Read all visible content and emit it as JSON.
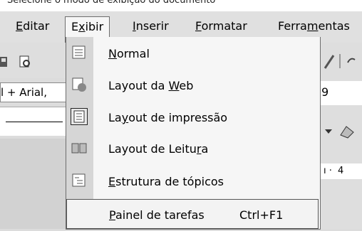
{
  "caption": "Selecione o modo de exibição do documento",
  "menubar": {
    "items": [
      {
        "label": "Editar",
        "ul": "E"
      },
      {
        "label": "Exibir",
        "ul": "x"
      },
      {
        "label": "Inserir",
        "ul": "I"
      },
      {
        "label": "Formatar",
        "ul": "F"
      },
      {
        "label": "Ferramentas",
        "ul": "m"
      }
    ]
  },
  "font_box": {
    "value": "l + Arial,"
  },
  "size_box": {
    "value": "9"
  },
  "ruler": {
    "mark": "4"
  },
  "dropdown": {
    "items": [
      {
        "label": "Normal",
        "ul_index": 0
      },
      {
        "label": "Layout da Web",
        "ul_index": 10
      },
      {
        "label": "Layout de impressão",
        "ul_index": 2
      },
      {
        "label": "Layout de Leitura",
        "ul_index": 15
      },
      {
        "label": "Estrutura de tópicos",
        "ul_index": 0
      },
      {
        "label": "Painel de tarefas",
        "ul_index": 0,
        "shortcut": "Ctrl+F1"
      }
    ]
  },
  "colors": {
    "menu_bg": "#e0e0e0",
    "dropdown_bg": "#f6f6f6",
    "border": "#6d6d6d"
  }
}
